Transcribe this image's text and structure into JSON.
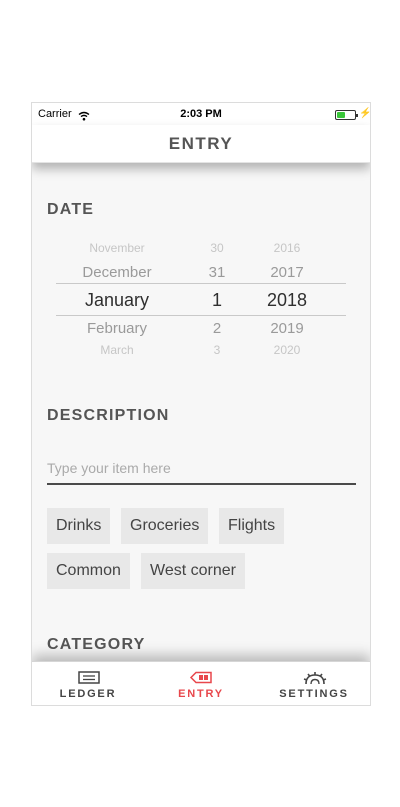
{
  "status_bar": {
    "carrier": "Carrier",
    "time": "2:03 PM"
  },
  "header": {
    "title": "ENTRY"
  },
  "date_section": {
    "title": "DATE",
    "picker": {
      "rows": [
        {
          "month": "November",
          "day": "30",
          "year": "2016"
        },
        {
          "month": "December",
          "day": "31",
          "year": "2017"
        },
        {
          "month": "January",
          "day": "1",
          "year": "2018"
        },
        {
          "month": "February",
          "day": "2",
          "year": "2019"
        },
        {
          "month": "March",
          "day": "3",
          "year": "2020"
        }
      ],
      "selected": {
        "month": "January",
        "day": "1",
        "year": "2018"
      }
    }
  },
  "description_section": {
    "title": "DESCRIPTION",
    "input": {
      "value": "",
      "placeholder": "Type your item here"
    },
    "chips": [
      "Drinks",
      "Groceries",
      "Flights",
      "Common",
      "West corner"
    ]
  },
  "category_section": {
    "title": "CATEGORY"
  },
  "tab_bar": {
    "tabs": [
      {
        "label": "LEDGER",
        "icon": "ledger-icon",
        "active": false
      },
      {
        "label": "ENTRY",
        "icon": "entry-icon",
        "active": true
      },
      {
        "label": "SETTINGS",
        "icon": "settings-icon",
        "active": false
      }
    ]
  },
  "colors": {
    "accent": "#e8474c",
    "battery": "#39c639",
    "chip_bg": "#e8e8e8",
    "content_bg": "#f7f7f7"
  }
}
